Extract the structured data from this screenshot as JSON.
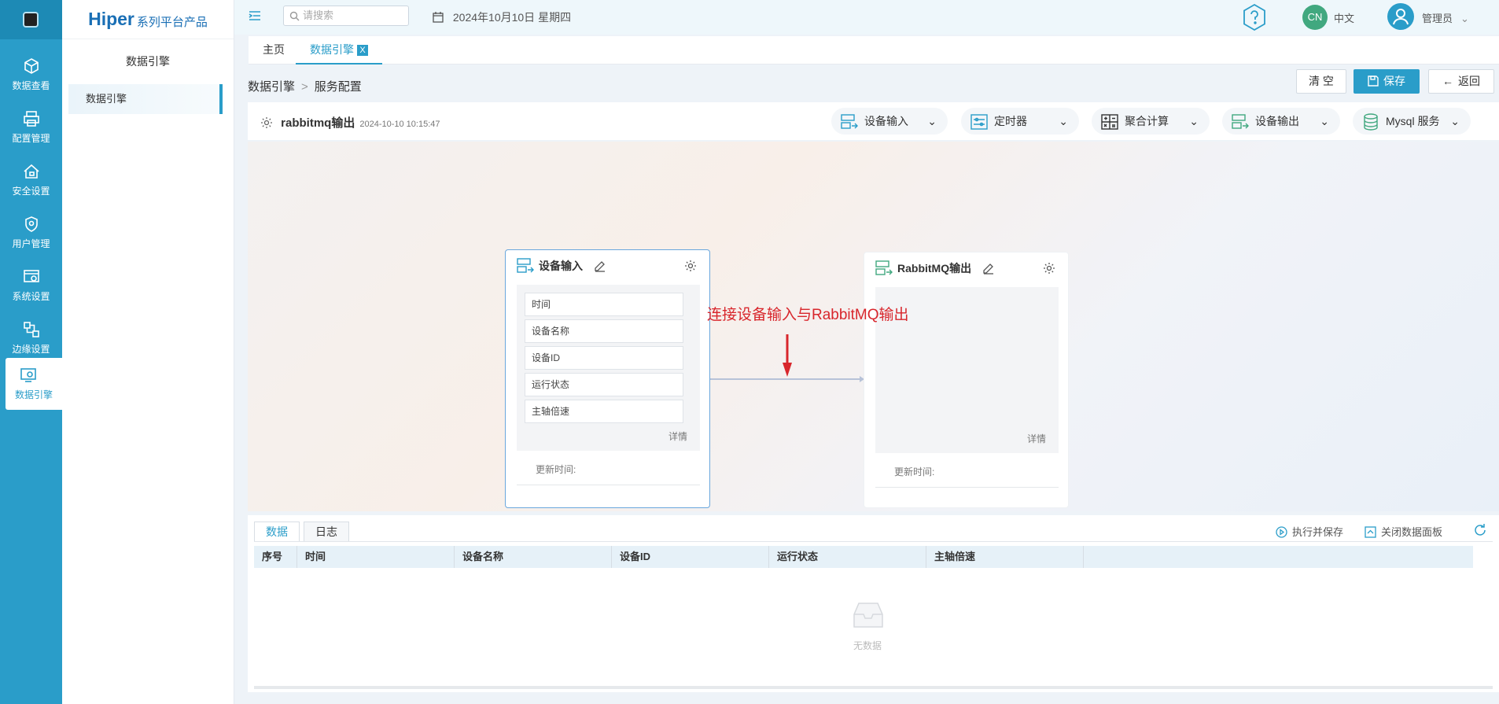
{
  "nav": {
    "items": [
      {
        "label": "数据查看",
        "icon": "cube-icon"
      },
      {
        "label": "配置管理",
        "icon": "printer-icon"
      },
      {
        "label": "安全设置",
        "icon": "home-lock-icon"
      },
      {
        "label": "用户管理",
        "icon": "shield-user-icon"
      },
      {
        "label": "系统设置",
        "icon": "settings-panel-icon"
      },
      {
        "label": "边缘设置",
        "icon": "edge-nodes-icon"
      },
      {
        "label": "数据引擎",
        "icon": "data-engine-icon"
      }
    ],
    "active": "数据引擎"
  },
  "brand": {
    "name": "Hiper",
    "tagline": "系列平台产品"
  },
  "sidebar": {
    "title": "数据引擎",
    "item": "数据引擎"
  },
  "header": {
    "search_placeholder": "请搜索",
    "date": "2024年10月10日 星期四",
    "lang_badge": "CN",
    "lang": "中文",
    "user": "管理员"
  },
  "tabs": [
    {
      "label": "主页"
    },
    {
      "label": "数据引擎",
      "close": "X"
    }
  ],
  "breadcrumb": {
    "root": "数据引擎",
    "separator": ">",
    "current": "服务配置"
  },
  "actions": {
    "clear": "清 空",
    "save": "保存",
    "back": "返回"
  },
  "flow": {
    "name": "rabbitmq输出",
    "timestamp": "2024-10-10 10:15:47",
    "toolbar": [
      "设备输入",
      "定时器",
      "聚合计算",
      "设备输出",
      "Mysql 服务"
    ]
  },
  "nodes": {
    "input": {
      "title": "设备输入",
      "fields": [
        "时间",
        "设备名称",
        "设备ID",
        "运行状态",
        "主轴倍速"
      ],
      "detail": "详情",
      "update_label": "更新时间:"
    },
    "output": {
      "title": "RabbitMQ输出",
      "detail": "详情",
      "update_label": "更新时间:"
    }
  },
  "annotation": "连接设备输入与RabbitMQ输出",
  "panel": {
    "tabs": [
      "数据",
      "日志"
    ],
    "run_save": "执行并保存",
    "close_panel": "关闭数据面板",
    "columns": [
      "序号",
      "时间",
      "设备名称",
      "设备ID",
      "运行状态",
      "主轴倍速"
    ],
    "empty": "无数据"
  },
  "colors": {
    "primary": "#2a9dc9",
    "annotation": "#d8262c",
    "lang_badge": "#41a87f"
  }
}
